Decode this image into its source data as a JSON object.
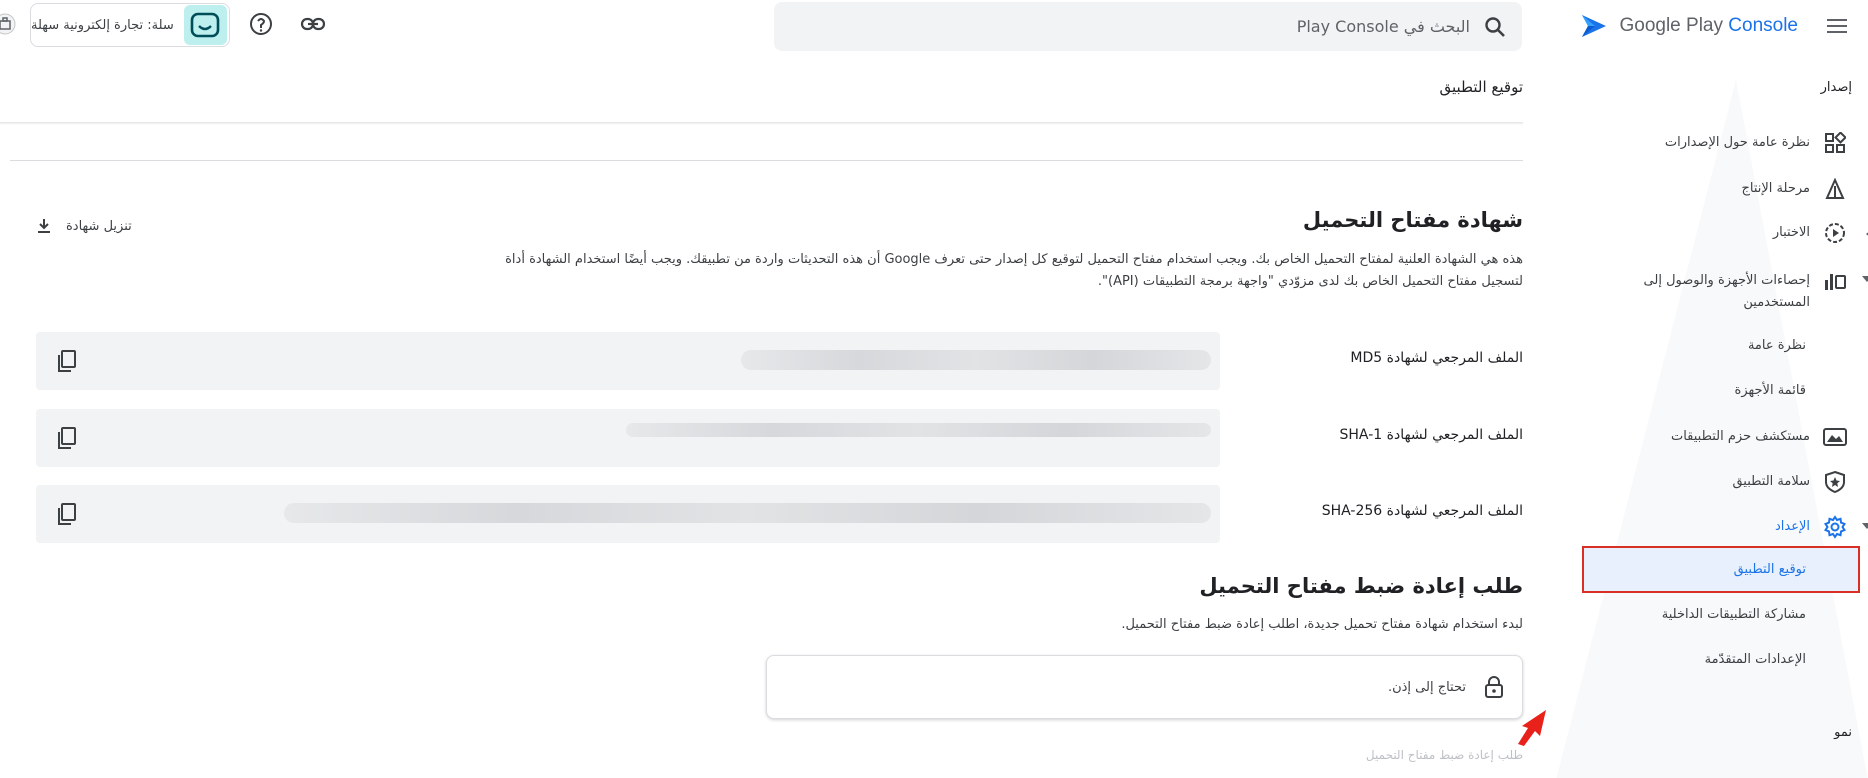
{
  "brand": {
    "name_prefix": "Google Play",
    "name_suffix": "Console"
  },
  "search": {
    "placeholder": "البحث في Play Console"
  },
  "top_left": {
    "app_name": "سلة: تجارة إلكترونية سهلة"
  },
  "sidebar": {
    "section_release": "إصدار",
    "items": [
      {
        "label": "نظرة عامة حول الإصدارات",
        "icon": "dashboard-icon"
      },
      {
        "label": "مرحلة الإنتاج",
        "icon": "production-icon"
      },
      {
        "label": "الاختبار",
        "icon": "testing-icon"
      },
      {
        "label": "إحصاءات الأجهزة والوصول إلى المستخدمين",
        "icon": "stats-icon"
      },
      {
        "label": "مستكشف حزم التطبيقات",
        "icon": "bundle-explorer-icon"
      },
      {
        "label": "سلامة التطبيق",
        "icon": "app-integrity-icon"
      },
      {
        "label": "الإعداد",
        "icon": "gear-icon"
      }
    ],
    "stats_sub": [
      "نظرة عامة",
      "قائمة الأجهزة"
    ],
    "setup_sub": [
      "توقيع التطبيق",
      "مشاركة التطبيقات الداخلية",
      "الإعدادات المتقدّمة"
    ],
    "section_growth": "نمو"
  },
  "main": {
    "page_title": "توقيع التطبيق",
    "cert": {
      "heading": "شهادة مفتاح التحميل",
      "desc_line1": "هذه هي الشهادة العلنية لمفتاح التحميل الخاص بك. ويجب استخدام مفتاح التحميل لتوقيع كل إصدار حتى تعرف Google أن هذه التحديثات واردة من تطبيقك. ويجب أيضًا استخدام الشهادة أداة",
      "desc_line2": "لتسجيل مفتاح التحميل الخاص بك لدى مزوّدي \"واجهة برمجة التطبيقات (API)\".",
      "download_label": "تنزيل شهادة",
      "rows": [
        {
          "label": "الملف المرجعي لشهادة MD5"
        },
        {
          "label": "الملف المرجعي لشهادة SHA-1"
        },
        {
          "label": "الملف المرجعي لشهادة SHA-256"
        }
      ]
    },
    "reset": {
      "heading": "طلب إعادة ضبط مفتاح التحميل",
      "desc": "لبدء استخدام شهادة مفتاح تحميل جديدة، اطلب إعادة ضبط مفتاح التحميل.",
      "permission_text": "تحتاج إلى إذن.",
      "link_label": "طلب إعادة ضبط مفتاح التحميل"
    }
  },
  "colors": {
    "accent": "#1a73e8",
    "highlight_border": "#d93025",
    "selected_bg": "#e8f0fe"
  }
}
